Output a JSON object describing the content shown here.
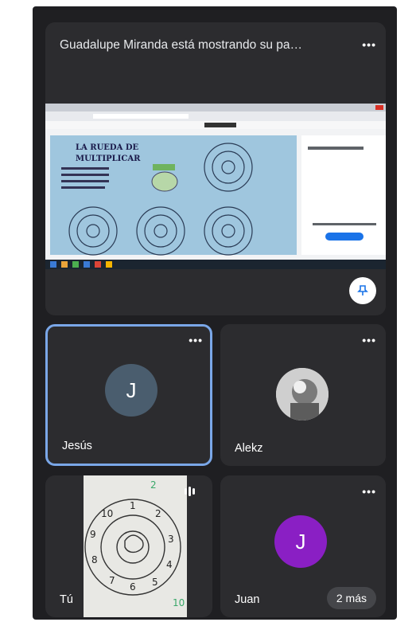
{
  "presentation": {
    "title": "Guadalupe Miranda está mostrando su pa…",
    "menu_icon": "more-dots-icon",
    "pin_icon": "pin-icon",
    "worksheet_title_line1": "LA RUEDA DE",
    "worksheet_title_line2": "MULTIPLICAR"
  },
  "participants": [
    {
      "name": "Jesús",
      "initial": "J",
      "avatar_color": "#4a5d6e",
      "active": true
    },
    {
      "name": "Alekz",
      "avatar_type": "photo"
    },
    {
      "name": "Tú",
      "wheel_numbers": [
        "2",
        "10",
        "1",
        "2",
        "9",
        "3",
        "8",
        "4",
        "7",
        "6",
        "5",
        "10"
      ]
    },
    {
      "name": "Juan",
      "initial": "J",
      "avatar_color": "#8a1fc4"
    }
  ],
  "more_badge": "2 más",
  "colors": {
    "background": "#1f1f22",
    "tile": "#2c2c2f",
    "active_border": "#7aa7e8"
  }
}
